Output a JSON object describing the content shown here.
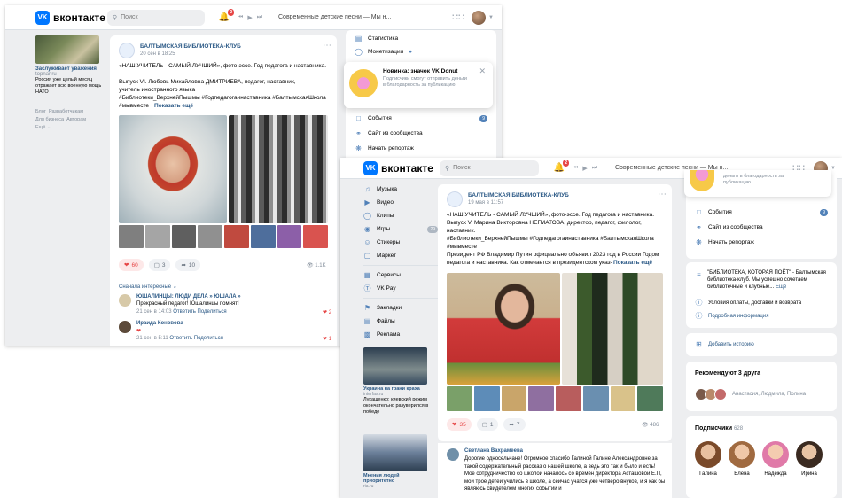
{
  "topbar": {
    "logo_text": "вконтакте",
    "logo_mark": "VK",
    "search_placeholder": "Поиск",
    "notifications_count": "2",
    "now_playing": "Современные детские песни — Мы н..."
  },
  "left": {
    "ad_title": "Заслуживает уважения",
    "ad_domain": "topnar.ru",
    "ad_text": "Россия уже целый месяц отражает всю военную мощь НАТО",
    "footer_links": [
      "Блог",
      "Разработчикам",
      "Для бизнеса",
      "Авторам",
      "Ещё"
    ],
    "ads_b": [
      {
        "title": "Украина на грани краха",
        "domain": "interfax.ru",
        "text": "Лукашенко: киевский режим окончательно разуверился в победе"
      },
      {
        "title": "Мнения людей приоритетно",
        "domain": "ria.ru",
        "text": ""
      }
    ]
  },
  "nav": [
    {
      "label": "Музыка",
      "icon": "music-icon"
    },
    {
      "label": "Видео",
      "icon": "video-icon"
    },
    {
      "label": "Клипы",
      "icon": "clips-icon"
    },
    {
      "label": "Игры",
      "icon": "games-icon",
      "count": "29"
    },
    {
      "label": "Стикеры",
      "icon": "stickers-icon"
    },
    {
      "label": "Маркет",
      "icon": "market-icon"
    },
    {
      "label": "Сервисы",
      "icon": "services-icon"
    },
    {
      "label": "VK Pay",
      "icon": "vkpay-icon"
    },
    {
      "label": "Закладки",
      "icon": "bookmarks-icon"
    },
    {
      "label": "Файлы",
      "icon": "files-icon"
    },
    {
      "label": "Реклама",
      "icon": "ads-icon"
    }
  ],
  "postA": {
    "author": "БАЛТЫМСКАЯ БИБЛИОТЕКА-КЛУБ",
    "date": "20 сен в 18:25",
    "headline": "«НАШ УЧИТЕЛЬ - САМЫЙ ЛУЧШИЙ», фото-эссе. Год педагога и наставника.",
    "body": "Выпуск VI. Любовь Михайловна ДМИТРИЕВА, педагог, наставник, учитель иностранного языка",
    "tags": "#Библиотеки_ВерхнейПышмы #Годпедагогаинаставника #БалтымскаяШкола #мывместе",
    "show_more": "Показать ещё",
    "likes": "60",
    "comments": "3",
    "reposts": "10",
    "views": "1.1K",
    "sort_label": "Сначала интересные",
    "comments_list": [
      {
        "author": "ЮШАЛИНЦЫ: ЛЮДИ ДЕЛА » ЮШАЛА »",
        "text": "Прекрасный педагог! Юшалинцы помнят!",
        "date": "21 сен в 14:03",
        "reply": "Ответить",
        "share": "Поделиться",
        "likes": "2"
      },
      {
        "author": "Ираида Коновова",
        "text": "❤",
        "date": "21 сен в 5:11",
        "reply": "Ответить",
        "share": "Поделиться",
        "likes": "1"
      }
    ]
  },
  "postB": {
    "author": "БАЛТЫМСКАЯ БИБЛИОТЕКА-КЛУБ",
    "date": "19 мая в 11:57",
    "headline": "«НАШ УЧИТЕЛЬ - САМЫЙ ЛУЧШИЙ», фото-эссе. Год педагога и наставника.",
    "body": "Выпуск V. Марина Викторовна НЕГМАТОВА, директор, педагог, филолог, наставник.",
    "tags": "#Библиотеки_ВерхнейПышмы #Годпедагогаинаставника #БалтымскаяШкола #мывместе",
    "body2": "Президент РФ Владимир Путин официально объявил 2023 год в России Годом педагога и наставника. Как отмечается в президентском указ-",
    "show_more": "Показать ещё",
    "likes": "35",
    "comments": "1",
    "reposts": "7",
    "views": "486",
    "comment_author": "Светлана Вахрамеева",
    "comment_text": "Дорогие однoсельчане! Огромное спасибо Галиной Галине Александровне за такой содержательный рассказ о нашей школе, а ведь это так и было и есть! Мое сотрудничество со школой началось со времён директора Асташовой Е.П, мои трое детей учились в школе, а сейчас учатся уже четверо внуков, и я как бы являюсь свидетелем многих событий и"
  },
  "rightA": {
    "menu_top": [
      "Статистика",
      "Монетизация"
    ],
    "popup_title": "Новинка: значок VK Donut",
    "popup_text": "Подписчики смогут отправить деньги в благодарность за публикацию",
    "menu": [
      {
        "label": "События",
        "icon": "events-icon",
        "count": "9"
      },
      {
        "label": "Сайт из сообщества",
        "icon": "globe-icon"
      },
      {
        "label": "Начать репортаж",
        "icon": "live-icon"
      }
    ]
  },
  "rightB": {
    "popup_tail": "деньги в благодарность за публикацию",
    "menu": [
      {
        "label": "События",
        "icon": "events-icon",
        "count": "9"
      },
      {
        "label": "Сайт из сообщества",
        "icon": "globe-icon"
      },
      {
        "label": "Начать репортаж",
        "icon": "live-icon"
      }
    ],
    "about_text": "\"БИБЛИОТЕКА, КОТОРАЯ ПОЁТ\" - Балтымская библиотека-клуб. Мы успешно сочетаем библиотечные и клубные...",
    "about_more": "Ещё",
    "terms": "Условия оплаты, доставки и возврата",
    "details": "Подробная информация",
    "add_story": "Добавить историю",
    "recommend_title": "Рекомендуют 3 друга",
    "recommend_names": "Анастасия, Людмила, Полина",
    "subscribers_label": "Подписчики",
    "subscribers_count": "628",
    "subscribers": [
      "Галина",
      "Елена",
      "Надежда",
      "Ирина"
    ]
  },
  "colors": {
    "accent": "#0077ff",
    "link": "#2a5885",
    "like": "#e64646",
    "bg": "#edeef0"
  }
}
